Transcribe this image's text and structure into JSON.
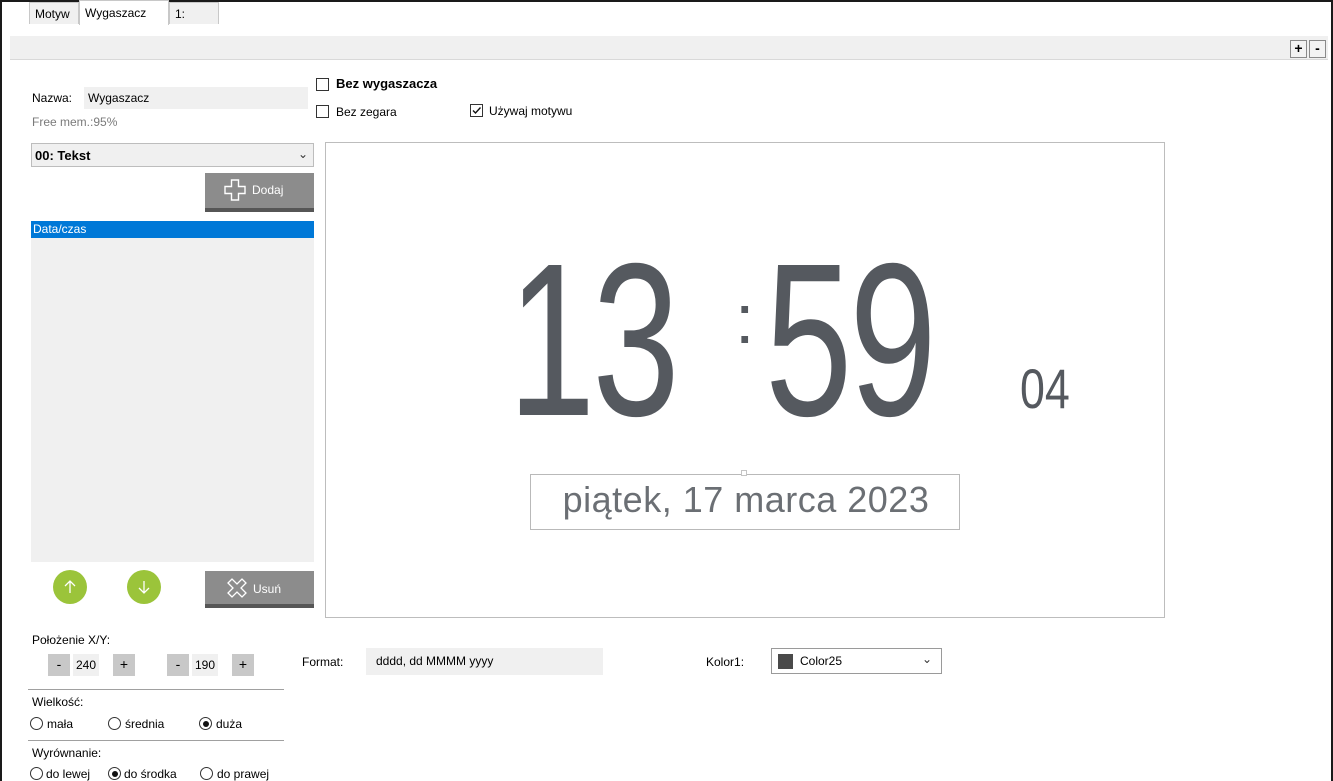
{
  "tabs": [
    {
      "label": "Motyw"
    },
    {
      "label": "Wygaszacz"
    },
    {
      "label": "1:"
    }
  ],
  "toolbar": {
    "plus": "+",
    "minus": "-"
  },
  "left": {
    "name_label": "Nazwa:",
    "name_value": "Wygaszacz",
    "free_mem": "Free mem.:95%",
    "type_selected": "00: Tekst",
    "add_label": "Dodaj",
    "list_items": [
      "Data/czas"
    ],
    "remove_label": "Usuń",
    "position_label": "Położenie X/Y:",
    "x_value": "240",
    "y_value": "190",
    "minus": "-",
    "plus": "+",
    "size_label": "Wielkość:",
    "size_options": [
      {
        "label": "mała",
        "selected": false
      },
      {
        "label": "średnia",
        "selected": false
      },
      {
        "label": "duża",
        "selected": true
      }
    ],
    "align_label": "Wyrównanie:",
    "align_options": [
      {
        "label": "do lewej",
        "selected": false
      },
      {
        "label": "do środka",
        "selected": true
      },
      {
        "label": "do prawej",
        "selected": false
      }
    ]
  },
  "options": {
    "no_screensaver": {
      "label": "Bez wygaszacza",
      "checked": false
    },
    "no_clock": {
      "label": "Bez zegara",
      "checked": false
    },
    "use_theme": {
      "label": "Używaj motywu",
      "checked": true
    }
  },
  "preview": {
    "hours": "13",
    "colon": ":",
    "minutes": "59",
    "seconds": "04",
    "date": "piątek, 17 marca 2023",
    "text_color": "#55595f"
  },
  "bottom": {
    "format_label": "Format:",
    "format_value": "dddd, dd MMMM yyyy",
    "color_label": "Kolor1:",
    "color_value": "Color25",
    "color_swatch": "#4a4a4a"
  },
  "colors": {
    "accent_green": "#9bc43a",
    "button_gray": "#8c8c8c",
    "selection_blue": "#0078d7"
  }
}
